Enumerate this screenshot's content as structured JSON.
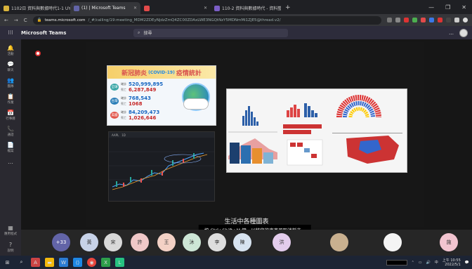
{
  "browser": {
    "tabs": [
      {
        "label": "1102日 資料與數據時代1-1 UY15",
        "color": "#d9b43c",
        "active": false
      },
      {
        "label": "(1) | Microsoft Teams",
        "color": "#6264a7",
        "active": true
      },
      {
        "label": "",
        "color": "#e24a4a",
        "active": false
      },
      {
        "label": "110-2 資料與數據時代 - 資料整",
        "color": "#7b5ec6",
        "active": false
      }
    ],
    "new_tab": "+",
    "url_host": "teams.microsoft.com",
    "url_path": "/_#/calling/19:meeting_MDM2ZDEyNjdzZmQ4ZC00ZDAxLWE3NGQtNzY5MDNmMi1ZJE5@thread.v2/",
    "nav": {
      "back": "←",
      "forward": "→",
      "reload": "C"
    },
    "window_controls": {
      "minimize": "—",
      "restore": "❐",
      "close": "✕"
    }
  },
  "teams": {
    "app_name": "Microsoft Teams",
    "search_placeholder": "搜尋",
    "more": "…",
    "rail": [
      {
        "label": "活動",
        "icon": "bell-icon",
        "glyph": "🔔",
        "active": false
      },
      {
        "label": "聊天",
        "icon": "chat-icon",
        "glyph": "💬",
        "active": true
      },
      {
        "label": "團隊",
        "icon": "teams-icon",
        "glyph": "👥",
        "active": false
      },
      {
        "label": "作業",
        "icon": "assignments-icon",
        "glyph": "📋",
        "active": false
      },
      {
        "label": "行事曆",
        "icon": "calendar-icon",
        "glyph": "📅",
        "active": false
      },
      {
        "label": "通話",
        "icon": "phone-icon",
        "glyph": "📞",
        "active": false
      },
      {
        "label": "檔案",
        "icon": "files-icon",
        "glyph": "📄",
        "active": false
      }
    ],
    "rail_more": "…",
    "rail_bottom": [
      {
        "label": "應用程式",
        "icon": "apps-icon",
        "glyph": "▦"
      },
      {
        "label": "說明",
        "icon": "help-icon",
        "glyph": "?"
      }
    ]
  },
  "share": {
    "covid": {
      "title": "新冠肺炎",
      "title_sub": "(COVID-19)",
      "title_tail": "疫情統計",
      "rows": [
        {
          "region": "全球",
          "color": "#3aa7a7",
          "confirmed_label": "確診",
          "confirmed": "520,999,895",
          "deaths_label": "死亡",
          "deaths": "6,287,849"
        },
        {
          "region": "台灣",
          "color": "#2c7fb8",
          "confirmed_label": "確診",
          "confirmed": "768,543",
          "deaths_label": "死亡",
          "deaths": "1068"
        },
        {
          "region": "美國",
          "color": "#e2574c",
          "confirmed_label": "確診",
          "confirmed": "84,209,473",
          "deaths_label": "死亡",
          "deaths": "1,026,646"
        }
      ]
    },
    "stock": {
      "ticker": "AAPL",
      "period": "1D"
    },
    "infographic": {
      "panel1_title": "Get more",
      "panel2_title": "Nonoptimistic data entries are mainly committed by young people",
      "panel3_title": "Results of the 2019 election",
      "panel4_title": "The Commons has 36 named working days until Brexit",
      "panel5_title": "Breakdown of Climate population by age group",
      "panel6_title": "Democrats take the House"
    },
    "caption": "按 Ctrl+Shift+M 鍵，以將您的麥克風取消靜音。",
    "subtitle": "生活中各種圖表"
  },
  "participants": [
    {
      "label": "+33",
      "color": "#6264a7",
      "text_color": "#ffffff"
    },
    {
      "label": "黃",
      "color": "#c7d2e8",
      "text_color": "#333333"
    },
    {
      "label": "宋",
      "color": "#d9d9d9",
      "text_color": "#333333"
    },
    {
      "label": "許",
      "color": "#f0c8c8",
      "text_color": "#333333"
    },
    {
      "label": "王",
      "color": "#f3d1c5",
      "text_color": "#333333"
    },
    {
      "label": "沐",
      "color": "#cde6d6",
      "text_color": "#333333"
    },
    {
      "label": "李",
      "color": "#dedede",
      "text_color": "#333333"
    },
    {
      "label": "陳",
      "color": "#d7e3f0",
      "text_color": "#333333"
    },
    {
      "label": "洪",
      "color": "#e3ccec",
      "text_color": "#333333"
    },
    {
      "label": "",
      "color": "#c9b08f",
      "text_color": "#333333"
    },
    {
      "label": "",
      "color": "#f4f4f4",
      "text_color": "#333333"
    },
    {
      "label": "施",
      "color": "#f2c4d0",
      "text_color": "#333333"
    }
  ],
  "taskbar": {
    "start": "⊞",
    "search": "⌕",
    "clock_time": "上午 10:55",
    "clock_date": "2022/5/1",
    "lang": "中",
    "notify": "💬"
  }
}
